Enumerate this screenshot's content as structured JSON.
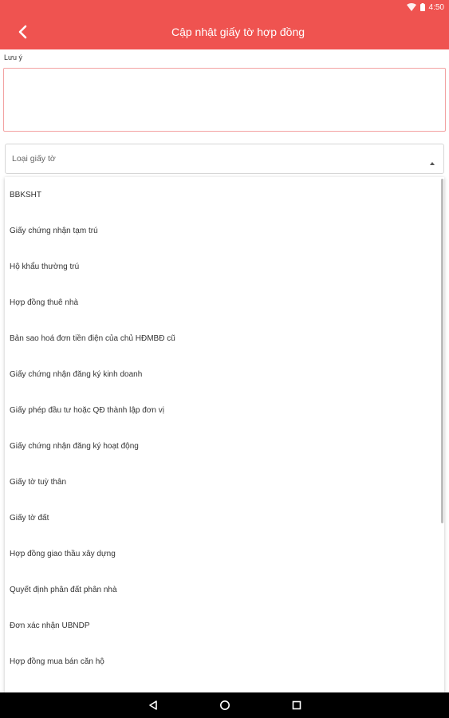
{
  "status_bar": {
    "time": "4:50"
  },
  "app_bar": {
    "title": "Cập nhật giấy tờ hợp đồng"
  },
  "note": {
    "label": "Lưu ý",
    "value": ""
  },
  "doc_type_select": {
    "placeholder": "Loại giấy tờ"
  },
  "dropdown": {
    "items": [
      {
        "label": "BBKSHT"
      },
      {
        "label": "Giấy chứng nhận tạm trú"
      },
      {
        "label": "Hộ khẩu thường trú"
      },
      {
        "label": "Hợp đồng thuê nhà"
      },
      {
        "label": "Bản sao hoá đơn tiền điện của chủ HĐMBĐ cũ"
      },
      {
        "label": "Giấy chứng nhận đăng ký kinh doanh"
      },
      {
        "label": "Giấy phép đầu tư hoặc QĐ thành lập đơn vị"
      },
      {
        "label": "Giấy chứng nhận đăng ký hoạt động"
      },
      {
        "label": "Giấy tờ tuỳ thân"
      },
      {
        "label": "Giấy tờ đất"
      },
      {
        "label": "Hợp đồng giao thầu xây dựng"
      },
      {
        "label": "Quyết định phân đất phân nhà"
      },
      {
        "label": "Đơn xác nhận UBNDP"
      },
      {
        "label": "Hợp đồng mua bán căn hộ"
      }
    ]
  },
  "colors": {
    "primary": "#ef5350",
    "note_border": "#f3a2a2",
    "nav_bar": "#000000"
  }
}
